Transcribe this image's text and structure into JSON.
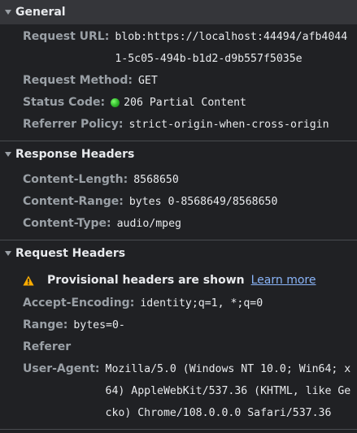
{
  "general": {
    "title": "General",
    "rows": [
      {
        "name": "Request URL:",
        "value": "blob:https://localhost:44494/afb40441-5c05-494b-b1d2-d9b557f5035e"
      },
      {
        "name": "Request Method:",
        "value": "GET"
      },
      {
        "name": "Status Code:",
        "value": "206 Partial Content",
        "status_color": "#2fb52a"
      },
      {
        "name": "Referrer Policy:",
        "value": "strict-origin-when-cross-origin"
      }
    ]
  },
  "response_headers": {
    "title": "Response Headers",
    "rows": [
      {
        "name": "Content-Length:",
        "value": "8568650"
      },
      {
        "name": "Content-Range:",
        "value": "bytes 0-8568649/8568650"
      },
      {
        "name": "Content-Type:",
        "value": "audio/mpeg"
      }
    ]
  },
  "request_headers": {
    "title": "Request Headers",
    "warning": {
      "icon": "warning-icon",
      "text": "Provisional headers are shown",
      "link": "Learn more"
    },
    "rows": [
      {
        "name": "Accept-Encoding:",
        "value": "identity;q=1, *;q=0"
      },
      {
        "name": "Range:",
        "value": "bytes=0-"
      },
      {
        "name": "Referer",
        "value": ""
      },
      {
        "name": "User-Agent:",
        "value": "Mozilla/5.0 (Windows NT 10.0; Win64; x64) AppleWebKit/537.36 (KHTML, like Gecko) Chrome/108.0.0.0 Safari/537.36"
      }
    ]
  },
  "colors": {
    "background": "#202124",
    "header_name": "#9aa0a6",
    "link": "#8ab4f8",
    "warning": "#f9ab00"
  }
}
